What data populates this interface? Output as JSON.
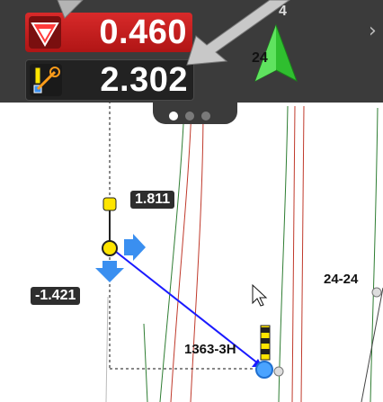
{
  "hud": {
    "offline_value": "0.460",
    "distance_value": "2.302",
    "page_indicator": {
      "count": 3,
      "active": 1
    },
    "next_chevron": "›",
    "partial_label_1": "24",
    "partial_label_2": "4"
  },
  "map": {
    "offset_vertical_label": "1.811",
    "offset_horizontal_label": "-1.421",
    "point_label_target": "1363-3H",
    "point_label_right": "24-24"
  },
  "colors": {
    "offline_red": "#c41e1e",
    "hud_bg": "#3b3b3b",
    "guide_line": "#1a1aff",
    "north_arrow": "#2fbf2f",
    "annotation_arrow": "#b4b4b4",
    "yellow_target": "#ffe500"
  },
  "icons": [
    "offline-triangle-icon",
    "distance-icon",
    "north-arrow-icon",
    "chevron-right-icon",
    "direction-arrow-right-icon",
    "direction-arrow-down-icon",
    "rod-target-icon",
    "cursor-icon"
  ]
}
